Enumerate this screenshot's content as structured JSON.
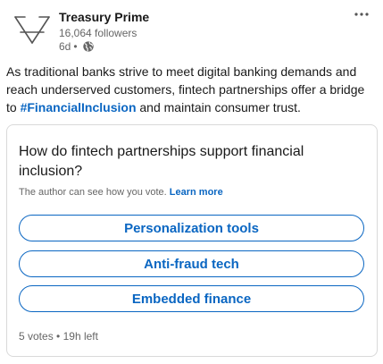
{
  "header": {
    "author_name": "Treasury Prime",
    "followers": "16,064 followers",
    "time_ago": "6d",
    "separator": "•",
    "logo_icon": "triangle-logo-icon",
    "visibility_icon": "globe-icon",
    "more_icon": "ellipsis-icon"
  },
  "post": {
    "text_before": "As traditional banks strive to meet digital banking demands and reach underserved customers, fintech partnerships offer a bridge to ",
    "hashtag": "#FinancialInclusion",
    "text_after": " and maintain consumer trust."
  },
  "poll": {
    "question": "How do fintech partnerships support financial inclusion?",
    "note": "The author can see how you vote.",
    "learn_more": "Learn more",
    "options": [
      {
        "label": "Personalization tools"
      },
      {
        "label": "Anti-fraud tech"
      },
      {
        "label": "Embedded finance"
      }
    ],
    "votes": "5 votes",
    "separator": "•",
    "time_left": "19h left"
  },
  "colors": {
    "link": "#0a66c2",
    "text": "#191919",
    "muted": "#666666",
    "border": "#d9d9d9"
  }
}
